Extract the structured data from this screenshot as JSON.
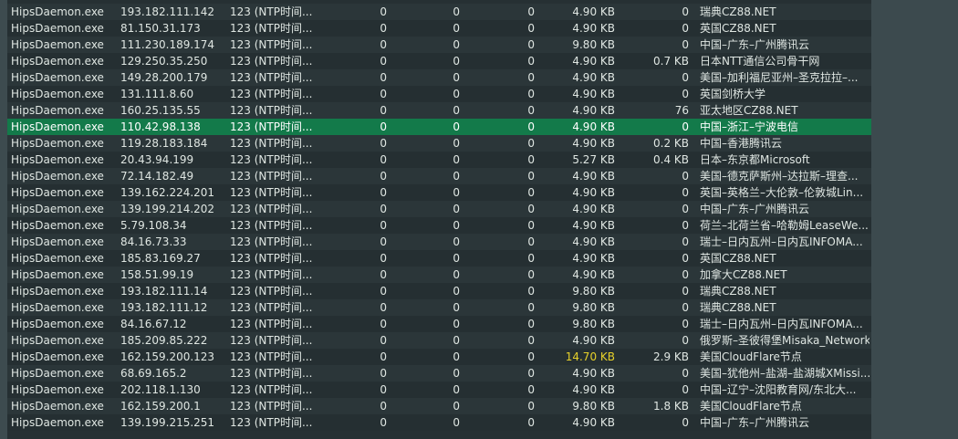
{
  "connections": {
    "colors": {
      "row_odd": "#2b3639",
      "row_even": "#252f32",
      "selected": "#137a4a",
      "highlight": "#e7d12a"
    },
    "rows": [
      {
        "process": "HipsDaemon.exe",
        "ip": "193.182.111.142",
        "port": "123 (NTP时间...",
        "c1": "0",
        "c2": "0",
        "c3": "0",
        "recv": "4.90 KB",
        "sent": "0",
        "location": "瑞典CZ88.NET"
      },
      {
        "process": "HipsDaemon.exe",
        "ip": "81.150.31.173",
        "port": "123 (NTP时间...",
        "c1": "0",
        "c2": "0",
        "c3": "0",
        "recv": "4.90 KB",
        "sent": "0",
        "location": "英国CZ88.NET"
      },
      {
        "process": "HipsDaemon.exe",
        "ip": "111.230.189.174",
        "port": "123 (NTP时间...",
        "c1": "0",
        "c2": "0",
        "c3": "0",
        "recv": "9.80 KB",
        "sent": "0",
        "location": "中国–广东–广州腾讯云"
      },
      {
        "process": "HipsDaemon.exe",
        "ip": "129.250.35.250",
        "port": "123 (NTP时间...",
        "c1": "0",
        "c2": "0",
        "c3": "0",
        "recv": "4.90 KB",
        "sent": "0.7 KB",
        "location": "日本NTT通信公司骨干网"
      },
      {
        "process": "HipsDaemon.exe",
        "ip": "149.28.200.179",
        "port": "123 (NTP时间...",
        "c1": "0",
        "c2": "0",
        "c3": "0",
        "recv": "4.90 KB",
        "sent": "0",
        "location": "美国–加利福尼亚州–圣克拉拉–..."
      },
      {
        "process": "HipsDaemon.exe",
        "ip": "131.111.8.60",
        "port": "123 (NTP时间...",
        "c1": "0",
        "c2": "0",
        "c3": "0",
        "recv": "4.90 KB",
        "sent": "0",
        "location": "英国剑桥大学"
      },
      {
        "process": "HipsDaemon.exe",
        "ip": "160.25.135.55",
        "port": "123 (NTP时间...",
        "c1": "0",
        "c2": "0",
        "c3": "0",
        "recv": "4.90 KB",
        "sent": "76",
        "location": "亚太地区CZ88.NET"
      },
      {
        "process": "HipsDaemon.exe",
        "ip": "110.42.98.138",
        "port": "123 (NTP时间...",
        "c1": "0",
        "c2": "0",
        "c3": "0",
        "recv": "4.90 KB",
        "sent": "0",
        "location": "中国–浙江–宁波电信",
        "selected": true
      },
      {
        "process": "HipsDaemon.exe",
        "ip": "119.28.183.184",
        "port": "123 (NTP时间...",
        "c1": "0",
        "c2": "0",
        "c3": "0",
        "recv": "4.90 KB",
        "sent": "0.2 KB",
        "location": "中国–香港腾讯云"
      },
      {
        "process": "HipsDaemon.exe",
        "ip": "20.43.94.199",
        "port": "123 (NTP时间...",
        "c1": "0",
        "c2": "0",
        "c3": "0",
        "recv": "5.27 KB",
        "sent": "0.4 KB",
        "location": "日本–东京都Microsoft"
      },
      {
        "process": "HipsDaemon.exe",
        "ip": "72.14.182.49",
        "port": "123 (NTP时间...",
        "c1": "0",
        "c2": "0",
        "c3": "0",
        "recv": "4.90 KB",
        "sent": "0",
        "location": "美国–德克萨斯州–达拉斯–理查..."
      },
      {
        "process": "HipsDaemon.exe",
        "ip": "139.162.224.201",
        "port": "123 (NTP时间...",
        "c1": "0",
        "c2": "0",
        "c3": "0",
        "recv": "4.90 KB",
        "sent": "0",
        "location": "英国–英格兰–大伦敦–伦敦城Lin..."
      },
      {
        "process": "HipsDaemon.exe",
        "ip": "139.199.214.202",
        "port": "123 (NTP时间...",
        "c1": "0",
        "c2": "0",
        "c3": "0",
        "recv": "4.90 KB",
        "sent": "0",
        "location": "中国–广东–广州腾讯云"
      },
      {
        "process": "HipsDaemon.exe",
        "ip": "5.79.108.34",
        "port": "123 (NTP时间...",
        "c1": "0",
        "c2": "0",
        "c3": "0",
        "recv": "4.90 KB",
        "sent": "0",
        "location": "荷兰–北荷兰省–哈勒姆LeaseWe..."
      },
      {
        "process": "HipsDaemon.exe",
        "ip": "84.16.73.33",
        "port": "123 (NTP时间...",
        "c1": "0",
        "c2": "0",
        "c3": "0",
        "recv": "4.90 KB",
        "sent": "0",
        "location": "瑞士–日内瓦州–日内瓦INFOMA..."
      },
      {
        "process": "HipsDaemon.exe",
        "ip": "185.83.169.27",
        "port": "123 (NTP时间...",
        "c1": "0",
        "c2": "0",
        "c3": "0",
        "recv": "4.90 KB",
        "sent": "0",
        "location": "英国CZ88.NET"
      },
      {
        "process": "HipsDaemon.exe",
        "ip": "158.51.99.19",
        "port": "123 (NTP时间...",
        "c1": "0",
        "c2": "0",
        "c3": "0",
        "recv": "4.90 KB",
        "sent": "0",
        "location": "加拿大CZ88.NET"
      },
      {
        "process": "HipsDaemon.exe",
        "ip": "193.182.111.14",
        "port": "123 (NTP时间...",
        "c1": "0",
        "c2": "0",
        "c3": "0",
        "recv": "9.80 KB",
        "sent": "0",
        "location": "瑞典CZ88.NET"
      },
      {
        "process": "HipsDaemon.exe",
        "ip": "193.182.111.12",
        "port": "123 (NTP时间...",
        "c1": "0",
        "c2": "0",
        "c3": "0",
        "recv": "9.80 KB",
        "sent": "0",
        "location": "瑞典CZ88.NET"
      },
      {
        "process": "HipsDaemon.exe",
        "ip": "84.16.67.12",
        "port": "123 (NTP时间...",
        "c1": "0",
        "c2": "0",
        "c3": "0",
        "recv": "9.80 KB",
        "sent": "0",
        "location": "瑞士–日内瓦州–日内瓦INFOMA..."
      },
      {
        "process": "HipsDaemon.exe",
        "ip": "185.209.85.222",
        "port": "123 (NTP时间...",
        "c1": "0",
        "c2": "0",
        "c3": "0",
        "recv": "4.90 KB",
        "sent": "0",
        "location": "俄罗斯–圣彼得堡Misaka_Network"
      },
      {
        "process": "HipsDaemon.exe",
        "ip": "162.159.200.123",
        "port": "123 (NTP时间...",
        "c1": "0",
        "c2": "0",
        "c3": "0",
        "recv": "14.70 KB",
        "sent": "2.9 KB",
        "location": "美国CloudFlare节点",
        "recv_highlight": true
      },
      {
        "process": "HipsDaemon.exe",
        "ip": "68.69.165.2",
        "port": "123 (NTP时间...",
        "c1": "0",
        "c2": "0",
        "c3": "0",
        "recv": "4.90 KB",
        "sent": "0",
        "location": "美国–犹他州–盐湖–盐湖城XMissi..."
      },
      {
        "process": "HipsDaemon.exe",
        "ip": "202.118.1.130",
        "port": "123 (NTP时间...",
        "c1": "0",
        "c2": "0",
        "c3": "0",
        "recv": "4.90 KB",
        "sent": "0",
        "location": "中国–辽宁–沈阳教育网/东北大..."
      },
      {
        "process": "HipsDaemon.exe",
        "ip": "162.159.200.1",
        "port": "123 (NTP时间...",
        "c1": "0",
        "c2": "0",
        "c3": "0",
        "recv": "9.80 KB",
        "sent": "1.8 KB",
        "location": "美国CloudFlare节点"
      },
      {
        "process": "HipsDaemon.exe",
        "ip": "139.199.215.251",
        "port": "123 (NTP时间...",
        "c1": "0",
        "c2": "0",
        "c3": "0",
        "recv": "4.90 KB",
        "sent": "0",
        "location": "中国–广东–广州腾讯云"
      }
    ]
  }
}
